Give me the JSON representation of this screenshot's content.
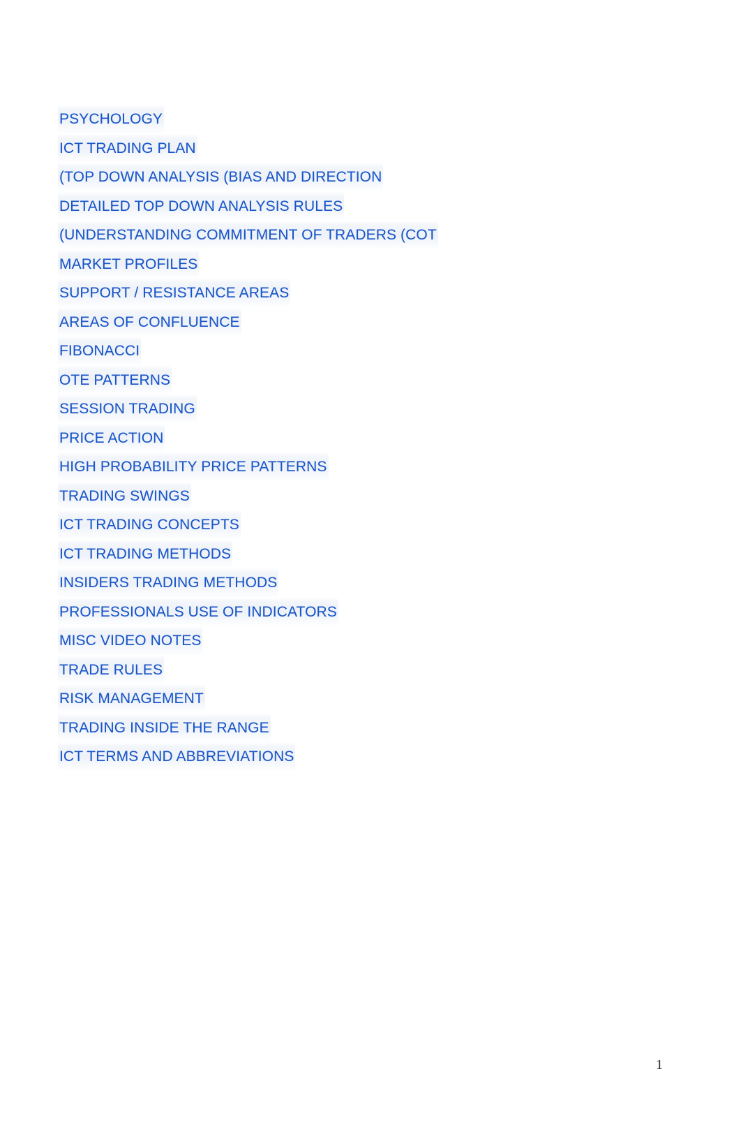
{
  "document": {
    "page_number": "1",
    "link_color": "#1a56c8",
    "background_color": "#ffffff"
  },
  "toc": {
    "entries": [
      {
        "label": "PSYCHOLOGY"
      },
      {
        "label": "ICT TRADING PLAN"
      },
      {
        "label": "(TOP DOWN ANALYSIS (BIAS AND DIRECTION"
      },
      {
        "label": "DETAILED TOP DOWN ANALYSIS RULES"
      },
      {
        "label": "(UNDERSTANDING COMMITMENT OF TRADERS (COT"
      },
      {
        "label": "MARKET PROFILES"
      },
      {
        "label": "SUPPORT / RESISTANCE AREAS"
      },
      {
        "label": "AREAS OF CONFLUENCE"
      },
      {
        "label": "FIBONACCI"
      },
      {
        "label": "OTE PATTERNS"
      },
      {
        "label": "SESSION TRADING"
      },
      {
        "label": "PRICE ACTION"
      },
      {
        "label": "HIGH PROBABILITY PRICE PATTERNS"
      },
      {
        "label": "TRADING SWINGS"
      },
      {
        "label": "ICT TRADING CONCEPTS"
      },
      {
        "label": "ICT TRADING METHODS"
      },
      {
        "label": "INSIDERS TRADING METHODS"
      },
      {
        "label": "PROFESSIONALS USE OF INDICATORS"
      },
      {
        "label": "MISC VIDEO NOTES"
      },
      {
        "label": "TRADE RULES"
      },
      {
        "label": "RISK MANAGEMENT"
      },
      {
        "label": "TRADING INSIDE THE RANGE"
      },
      {
        "label": "ICT TERMS AND ABBREVIATIONS"
      }
    ]
  }
}
